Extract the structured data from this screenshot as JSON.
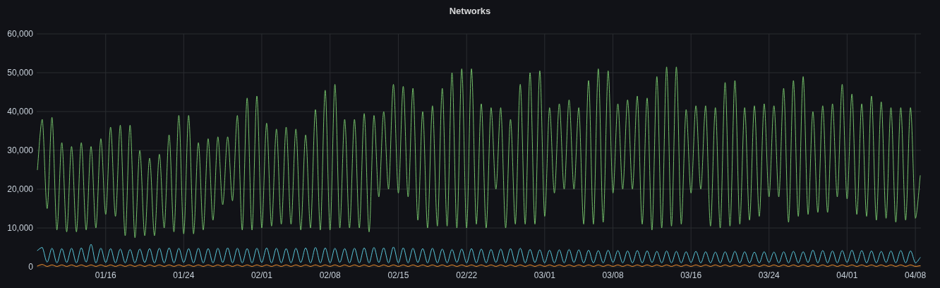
{
  "panel": {
    "title": "Networks",
    "chart_data": {
      "type": "line",
      "categories": [
        null,
        null,
        null,
        null,
        null,
        null,
        null,
        null,
        null,
        null,
        null,
        null,
        null,
        null,
        "01/16",
        null,
        null,
        null,
        null,
        null,
        null,
        null,
        null,
        null,
        null,
        null,
        null,
        null,
        null,
        null,
        "01/24",
        null,
        null,
        null,
        null,
        null,
        null,
        null,
        null,
        null,
        null,
        null,
        null,
        null,
        null,
        null,
        "02/01",
        null,
        null,
        null,
        null,
        null,
        null,
        null,
        null,
        null,
        null,
        null,
        null,
        null,
        "02/08",
        null,
        null,
        null,
        null,
        null,
        null,
        null,
        null,
        null,
        null,
        null,
        null,
        null,
        "02/15",
        null,
        null,
        null,
        null,
        null,
        null,
        null,
        null,
        null,
        null,
        null,
        null,
        null,
        "02/22",
        null,
        null,
        null,
        null,
        null,
        null,
        null,
        null,
        null,
        null,
        null,
        null,
        null,
        null,
        null,
        "03/01",
        null,
        null,
        null,
        null,
        null,
        null,
        null,
        null,
        null,
        null,
        null,
        null,
        null,
        "03/08",
        null,
        null,
        null,
        null,
        null,
        null,
        null,
        null,
        null,
        null,
        null,
        null,
        null,
        null,
        null,
        "03/16",
        null,
        null,
        null,
        null,
        null,
        null,
        null,
        null,
        null,
        null,
        null,
        null,
        null,
        null,
        null,
        "03/24",
        null,
        null,
        null,
        null,
        null,
        null,
        null,
        null,
        null,
        null,
        null,
        null,
        null,
        null,
        null,
        "04/01",
        null,
        null,
        null,
        null,
        null,
        null,
        null,
        null,
        null,
        null,
        null,
        null,
        null,
        "04/08",
        null
      ],
      "series": [
        {
          "color": "#73bf69",
          "values": [
            25000,
            38000,
            15000,
            38500,
            9500,
            32000,
            9000,
            31000,
            9000,
            32000,
            9500,
            31000,
            10000,
            33000,
            13500,
            36000,
            13000,
            36500,
            8000,
            36500,
            7500,
            30000,
            8000,
            28000,
            8000,
            29000,
            10000,
            34000,
            9000,
            39000,
            8500,
            39000,
            8500,
            32000,
            9500,
            33000,
            12000,
            33500,
            16000,
            33500,
            17000,
            39000,
            9500,
            43500,
            9500,
            44000,
            10000,
            37000,
            10500,
            35500,
            11000,
            36000,
            11000,
            35500,
            9500,
            34000,
            10000,
            40500,
            9500,
            45500,
            9500,
            47000,
            10000,
            38000,
            10000,
            38000,
            10000,
            39500,
            9000,
            39000,
            18000,
            40000,
            20000,
            47000,
            19000,
            46500,
            18000,
            46000,
            12000,
            40000,
            10000,
            41500,
            10500,
            46000,
            10500,
            50000,
            10000,
            51000,
            10000,
            51000,
            11000,
            42000,
            10000,
            41000,
            20000,
            41000,
            10000,
            38000,
            11000,
            47000,
            11000,
            50000,
            11000,
            50500,
            13000,
            41000,
            19000,
            42000,
            20000,
            43000,
            20000,
            41000,
            11000,
            48000,
            11000,
            51000,
            11500,
            50500,
            19000,
            42000,
            20000,
            43000,
            20000,
            44000,
            11000,
            43500,
            9500,
            49000,
            10000,
            51500,
            10500,
            51500,
            11000,
            40500,
            19000,
            41500,
            20000,
            41500,
            10500,
            41000,
            10000,
            47500,
            10500,
            48000,
            11000,
            41000,
            12000,
            41500,
            13000,
            42000,
            18000,
            41500,
            18000,
            46000,
            11500,
            48000,
            13000,
            49000,
            13500,
            40000,
            14000,
            41500,
            14000,
            42000,
            18000,
            47000,
            17500,
            44500,
            13500,
            42000,
            13000,
            44000,
            12000,
            42500,
            12500,
            41000,
            11500,
            41000,
            12000,
            41000,
            12500,
            23500
          ]
        },
        {
          "color": "#5ac8db",
          "values": [
            4200,
            5000,
            1200,
            4800,
            1000,
            4700,
            1100,
            4800,
            1000,
            4900,
            1200,
            5800,
            1000,
            4800,
            1100,
            4700,
            1000,
            4600,
            1000,
            4500,
            1000,
            4600,
            1100,
            4700,
            1000,
            4800,
            1000,
            4900,
            1000,
            4800,
            1100,
            4700,
            1000,
            4800,
            1000,
            4700,
            1000,
            4800,
            1100,
            4900,
            1000,
            4800,
            1000,
            4700,
            1000,
            4800,
            1100,
            4900,
            1000,
            4800,
            1000,
            4700,
            1000,
            4800,
            1100,
            4900,
            1000,
            5000,
            1000,
            4900,
            1000,
            4800,
            1100,
            4700,
            1000,
            4800,
            1000,
            4900,
            1000,
            5000,
            1100,
            4900,
            1000,
            5100,
            1000,
            4900,
            1000,
            4800,
            1100,
            4700,
            1000,
            4800,
            1000,
            4600,
            1000,
            4500,
            1100,
            4600,
            1000,
            4700,
            1000,
            4600,
            1000,
            4500,
            1100,
            4600,
            1000,
            4700,
            1000,
            4800,
            1000,
            4500,
            1100,
            4400,
            1000,
            4300,
            1000,
            4400,
            1000,
            4500,
            1100,
            4400,
            1000,
            4300,
            1000,
            4200,
            1000,
            4300,
            1100,
            4200,
            1000,
            4100,
            1000,
            4200,
            1000,
            4100,
            1100,
            4000,
            1000,
            4100,
            1000,
            4000,
            1000,
            3900,
            1100,
            4000,
            1000,
            3900,
            1000,
            3800,
            1000,
            3900,
            1100,
            4000,
            1000,
            3900,
            1000,
            3800,
            1000,
            3900,
            1100,
            3800,
            1000,
            3900,
            1000,
            4000,
            1000,
            3900,
            1100,
            4300,
            1000,
            4200,
            1000,
            4100,
            1000,
            4200,
            1100,
            4300,
            1000,
            4200,
            1000,
            4100,
            1000,
            4000,
            1100,
            4100,
            1000,
            4200,
            1000,
            4100,
            1000,
            2400
          ]
        },
        {
          "color": "#ff9830",
          "values": [
            200,
            600,
            100,
            500,
            100,
            500,
            100,
            500,
            100,
            500,
            100,
            500,
            100,
            500,
            100,
            500,
            100,
            500,
            100,
            500,
            100,
            500,
            100,
            500,
            100,
            500,
            100,
            500,
            100,
            500,
            100,
            500,
            100,
            500,
            100,
            500,
            100,
            500,
            100,
            500,
            100,
            500,
            100,
            500,
            100,
            500,
            100,
            500,
            100,
            500,
            100,
            500,
            100,
            500,
            100,
            500,
            100,
            500,
            100,
            500,
            100,
            500,
            100,
            500,
            100,
            500,
            100,
            500,
            100,
            500,
            100,
            500,
            100,
            500,
            100,
            500,
            100,
            500,
            100,
            500,
            100,
            500,
            100,
            500,
            100,
            500,
            100,
            500,
            100,
            500,
            100,
            500,
            100,
            500,
            100,
            500,
            100,
            500,
            100,
            500,
            100,
            500,
            100,
            500,
            100,
            500,
            100,
            500,
            100,
            500,
            100,
            500,
            100,
            500,
            100,
            500,
            100,
            500,
            100,
            500,
            100,
            500,
            100,
            500,
            100,
            500,
            100,
            500,
            100,
            500,
            100,
            500,
            100,
            500,
            100,
            500,
            100,
            500,
            100,
            500,
            100,
            500,
            100,
            500,
            100,
            500,
            100,
            500,
            100,
            500,
            100,
            500,
            100,
            500,
            100,
            500,
            100,
            500,
            100,
            500,
            100,
            500,
            100,
            500,
            100,
            500,
            100,
            500,
            100,
            500,
            100,
            500,
            100,
            500,
            100,
            500,
            100,
            500,
            100,
            500,
            100,
            300
          ]
        }
      ],
      "ylim": [
        0,
        60000
      ],
      "grid": true,
      "yticks": [
        {
          "value": 0,
          "label": "0"
        },
        {
          "value": 10000,
          "label": "10,000"
        },
        {
          "value": 20000,
          "label": "20,000"
        },
        {
          "value": 30000,
          "label": "30,000"
        },
        {
          "value": 40000,
          "label": "40,000"
        },
        {
          "value": 50000,
          "label": "50,000"
        },
        {
          "value": 60000,
          "label": "60,000"
        }
      ]
    }
  }
}
